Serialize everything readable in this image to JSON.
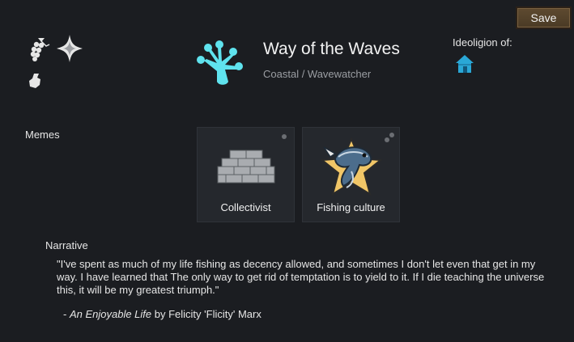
{
  "header": {
    "save_label": "Save",
    "ideoligion_label": "Ideoligion of:",
    "icons": [
      "grapes-icon",
      "sparkle-icon",
      "hand-icon",
      "house-icon"
    ]
  },
  "ideo": {
    "name": "Way of the Waves",
    "subtitle": "Coastal / Wavewatcher",
    "symbol_icon": "frog-foot-icon",
    "color": "#5fe3ee"
  },
  "memes": {
    "label": "Memes",
    "items": [
      {
        "label": "Collectivist",
        "icon": "brick-wall-icon"
      },
      {
        "label": "Fishing culture",
        "icon": "fish-star-icon"
      }
    ]
  },
  "narrative": {
    "label": "Narrative",
    "quote": "\"I've spent as much of my life fishing as decency allowed, and sometimes I don't let even that get in my way. I have learned that The only way to get rid of temptation is to yield to it. If I die teaching the universe this, it will be my greatest triumph.\"",
    "attribution_prefix": "- ",
    "book_title": "An Enjoyable Life",
    "attribution_suffix": " by Felicity 'Flicity' Marx"
  },
  "colors": {
    "background": "#1b1d21",
    "card": "#25282d",
    "button": "#5e4a30",
    "house": "#2aa7d6",
    "fish": "#4c6d8c",
    "star": "#f1c667"
  }
}
